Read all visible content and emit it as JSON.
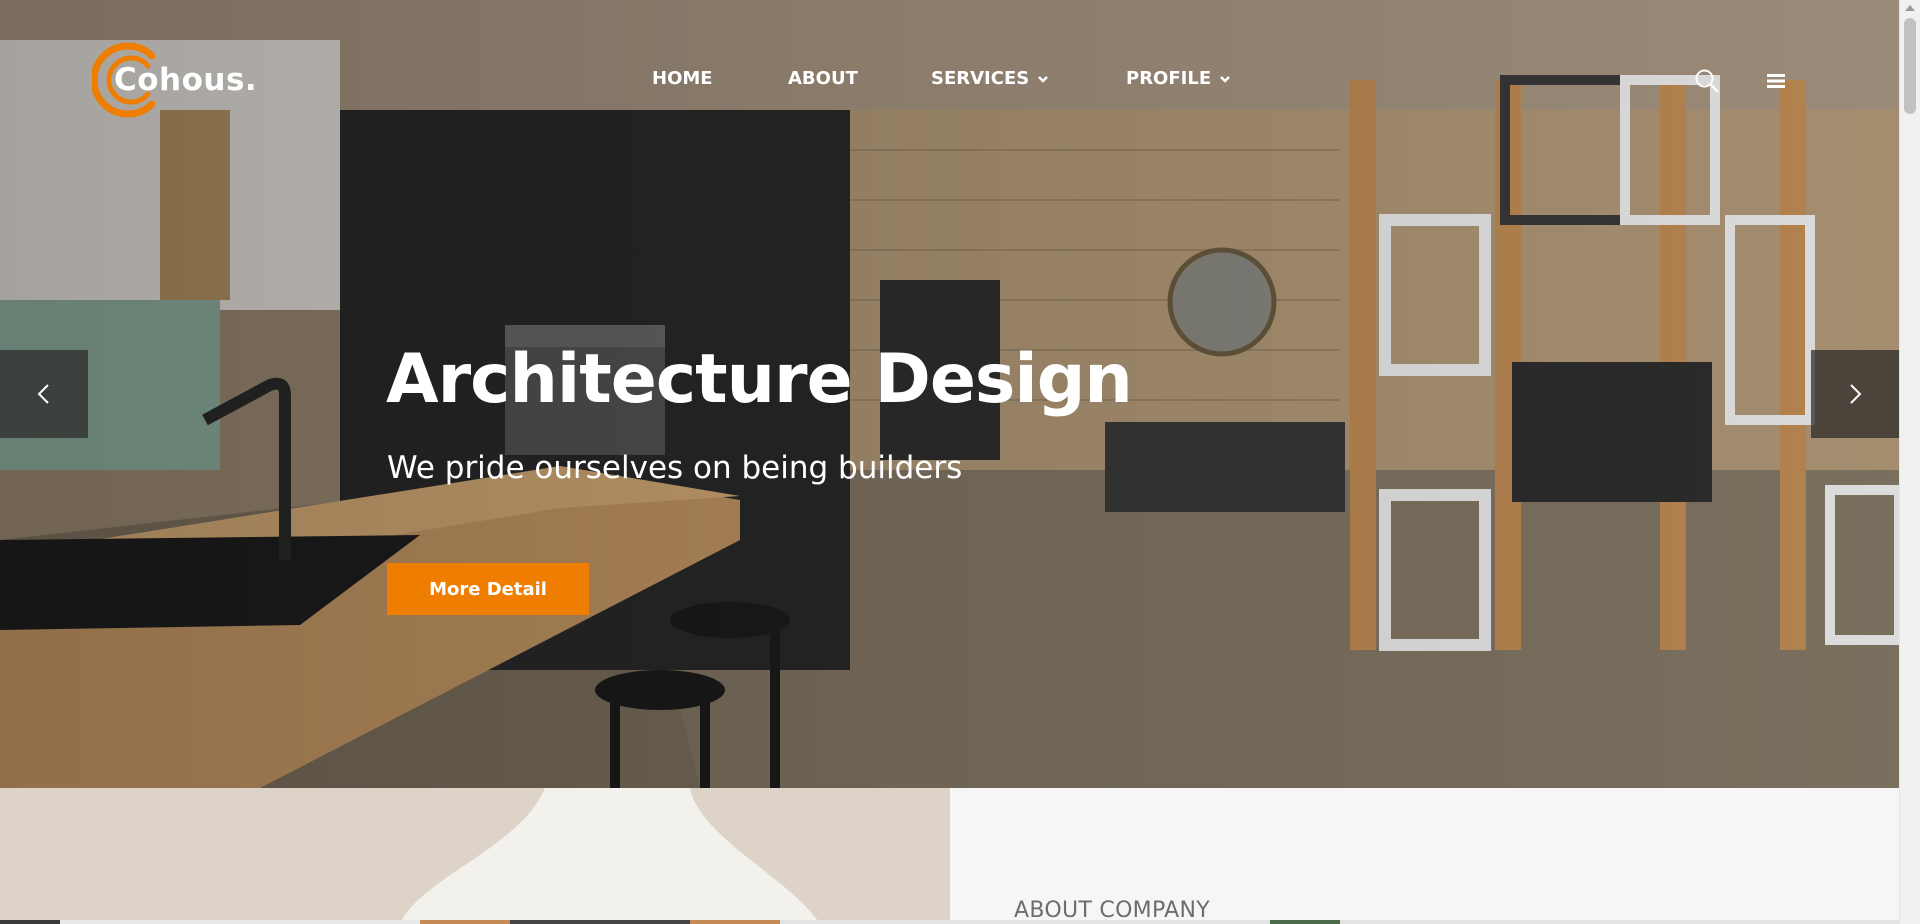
{
  "brand": {
    "name": "Cohous.",
    "accent": "#ef7d00"
  },
  "nav": {
    "items": [
      {
        "label": "HOME",
        "has_dropdown": false
      },
      {
        "label": "ABOUT",
        "has_dropdown": false
      },
      {
        "label": "SERVICES",
        "has_dropdown": true
      },
      {
        "label": "PROFILE",
        "has_dropdown": true
      }
    ],
    "icons": [
      "search-icon",
      "hamburger-menu-icon"
    ]
  },
  "hero": {
    "title": "Architecture Design",
    "subtitle": "We pride ourselves on being builders",
    "button_label": "More Detail",
    "button_color": "#ef7d00",
    "prev_icon": "chevron-left-icon",
    "next_icon": "chevron-right-icon"
  },
  "about": {
    "label": "ABOUT COMPANY"
  }
}
